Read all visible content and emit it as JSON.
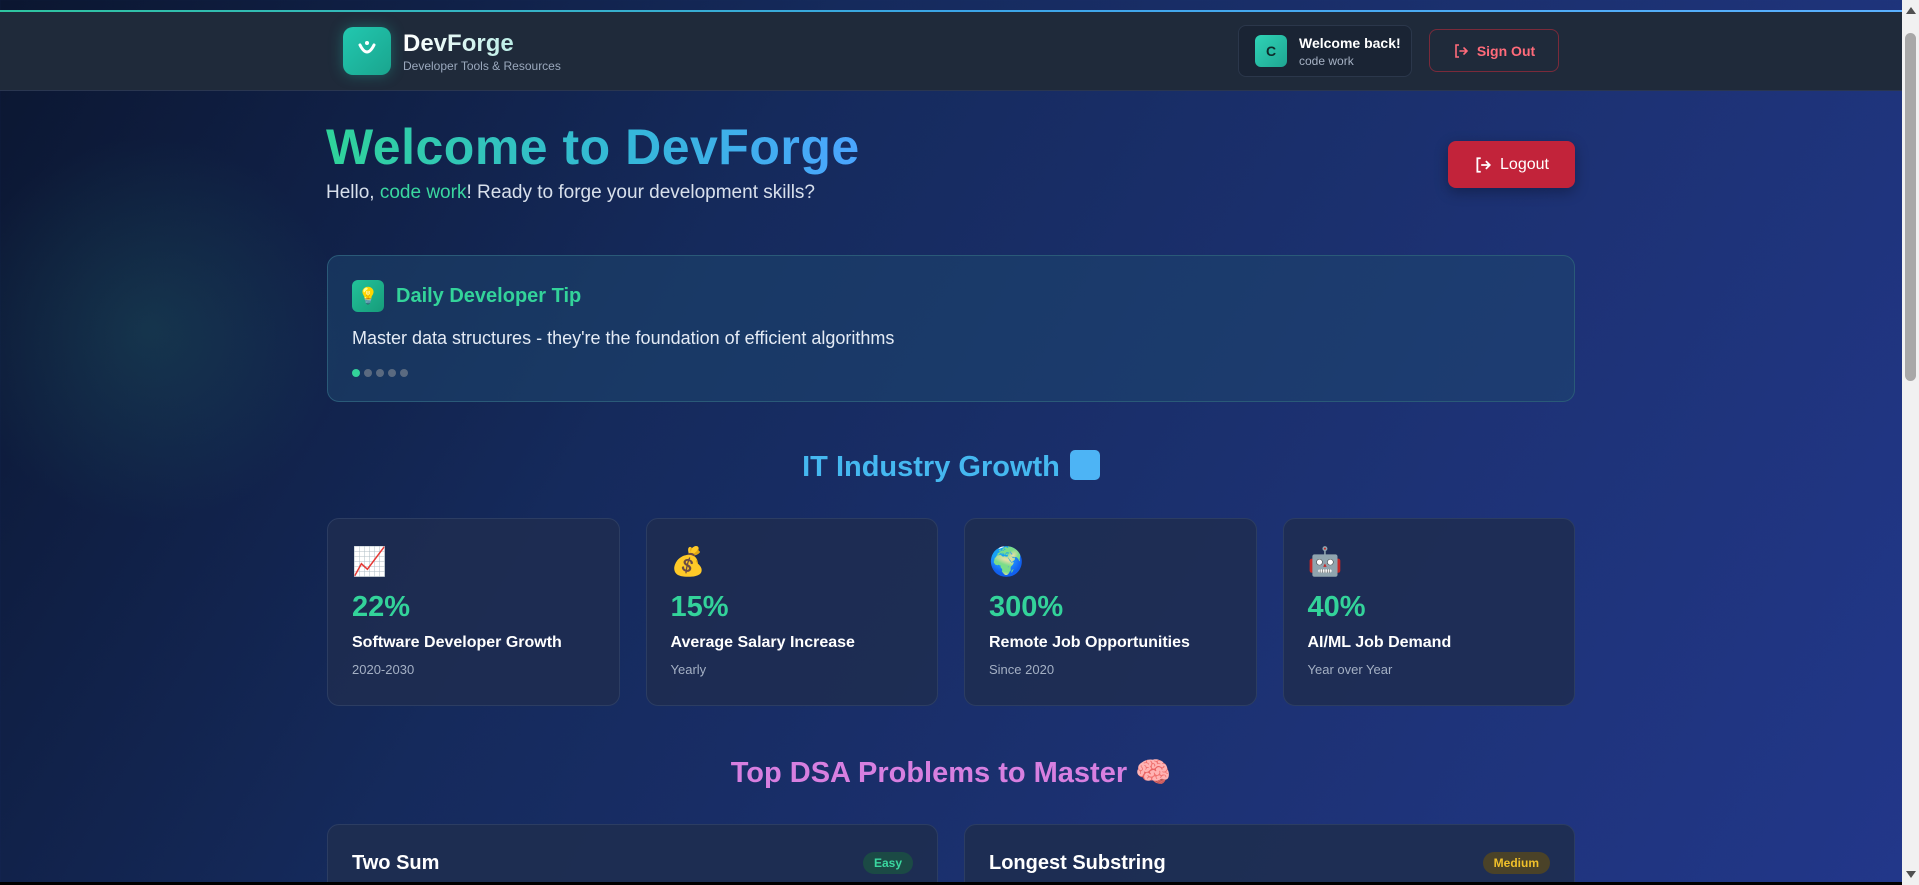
{
  "header": {
    "brand_name": "DevForge",
    "brand_sub": "Developer Tools & Resources",
    "welcome_title": "Welcome back!",
    "welcome_user": "code work",
    "avatar_letter": "C",
    "signout_label": "Sign Out"
  },
  "hero": {
    "title": "Welcome to DevForge",
    "greeting_prefix": "Hello, ",
    "user_name": "code work",
    "greeting_suffix": "! Ready to forge your development skills?",
    "logout_label": "Logout"
  },
  "tip": {
    "title": "Daily Developer Tip",
    "text": "Master data structures - they're the foundation of efficient algorithms",
    "dots_total": 5,
    "active_dot": 1
  },
  "growth": {
    "title": "IT Industry Growth",
    "cards": [
      {
        "icon": "chart-increasing-icon",
        "glyph": "📈",
        "value": "22%",
        "label": "Software Developer Growth",
        "sub": "2020-2030"
      },
      {
        "icon": "money-bag-icon",
        "glyph": "💰",
        "value": "15%",
        "label": "Average Salary Increase",
        "sub": "Yearly"
      },
      {
        "icon": "globe-icon",
        "glyph": "🌍",
        "value": "300%",
        "label": "Remote Job Opportunities",
        "sub": "Since 2020"
      },
      {
        "icon": "robot-icon",
        "glyph": "🤖",
        "value": "40%",
        "label": "AI/ML Job Demand",
        "sub": "Year over Year"
      }
    ]
  },
  "dsa": {
    "title": "Top DSA Problems to Master",
    "problems": [
      {
        "name": "Two Sum",
        "difficulty": "Easy"
      },
      {
        "name": "Longest Substring",
        "difficulty": "Medium"
      }
    ]
  },
  "colors": {
    "accent_green": "#33d39a",
    "accent_blue": "#45b8f0",
    "accent_purple": "#d77fe0",
    "logout_red": "#c2233a"
  }
}
